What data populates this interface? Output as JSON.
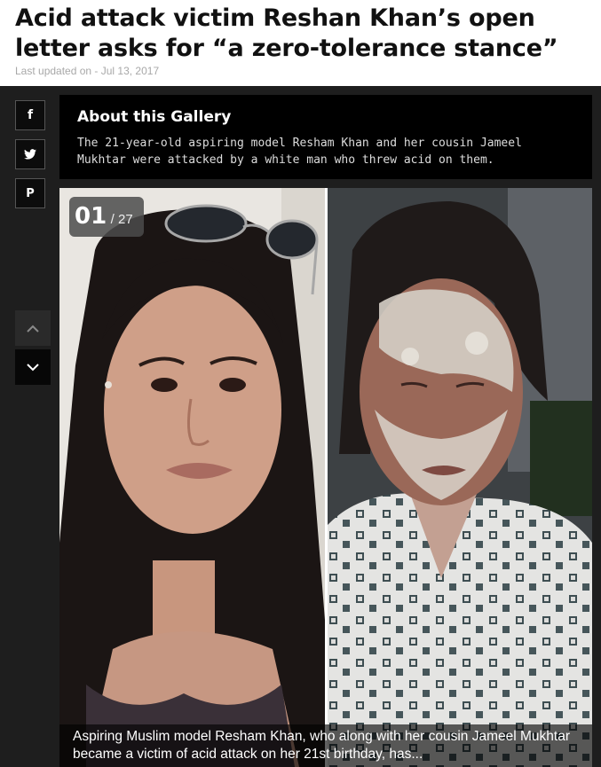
{
  "article": {
    "title": "Acid attack victim Reshan Khan’s open letter asks for “a zero-tolerance stance”",
    "updated": "Last updated on - Jul 13, 2017"
  },
  "share": {
    "facebook": "f",
    "pinterest": "P",
    "icons": [
      "facebook-icon",
      "twitter-icon",
      "pinterest-icon"
    ]
  },
  "nav": {
    "icons": [
      "chevron-up-icon",
      "chevron-down-icon"
    ]
  },
  "gallery": {
    "heading": "About this Gallery",
    "description": "The 21-year-old aspiring model Resham Khan and her cousin Jameel Mukhtar were attacked by a white man who threw acid on them.",
    "current": "01",
    "total": "/ 27",
    "caption": "Aspiring Muslim model Resham Khan, who along with her cousin Jameel Mukhtar became a victim of acid attack on her 21st birthday, has..."
  },
  "colors": {
    "background": "#1e1e1e",
    "panel": "#000000",
    "title": "#111111"
  }
}
